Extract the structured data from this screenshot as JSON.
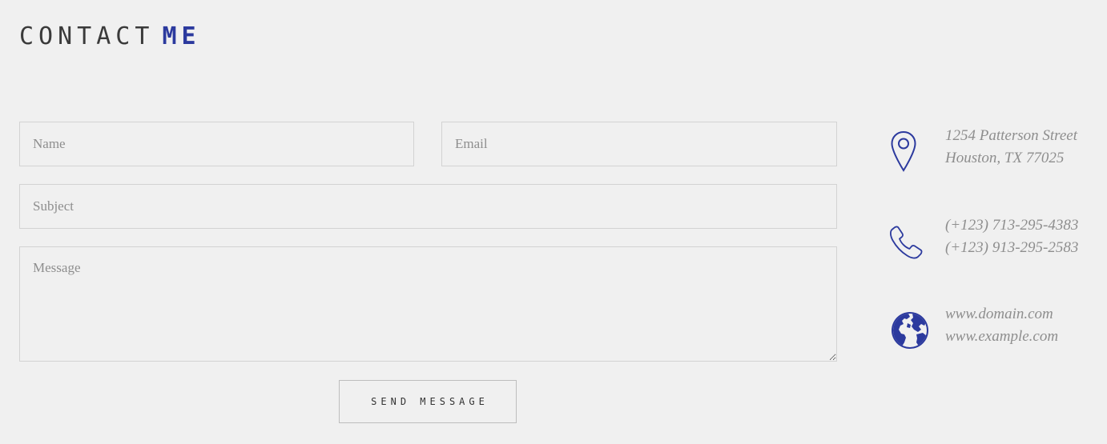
{
  "header": {
    "title_plain": "CONTACT",
    "title_accent": "ME"
  },
  "form": {
    "name_placeholder": "Name",
    "email_placeholder": "Email",
    "subject_placeholder": "Subject",
    "message_placeholder": "Message",
    "send_label": "SEND MESSAGE"
  },
  "contact_info": {
    "address": {
      "icon": "map-pin-icon",
      "line1": "1254 Patterson Street",
      "line2": "Houston, TX 77025"
    },
    "phone": {
      "icon": "phone-icon",
      "line1": "(+123) 713-295-4383",
      "line2": "(+123) 913-295-2583"
    },
    "web": {
      "icon": "globe-icon",
      "line1": "www.domain.com",
      "line2": "www.example.com"
    }
  },
  "colors": {
    "accent": "#2c3a9e",
    "background": "#f0f0f0",
    "muted_text": "#8e8e8e",
    "border": "#d3d3d3"
  }
}
